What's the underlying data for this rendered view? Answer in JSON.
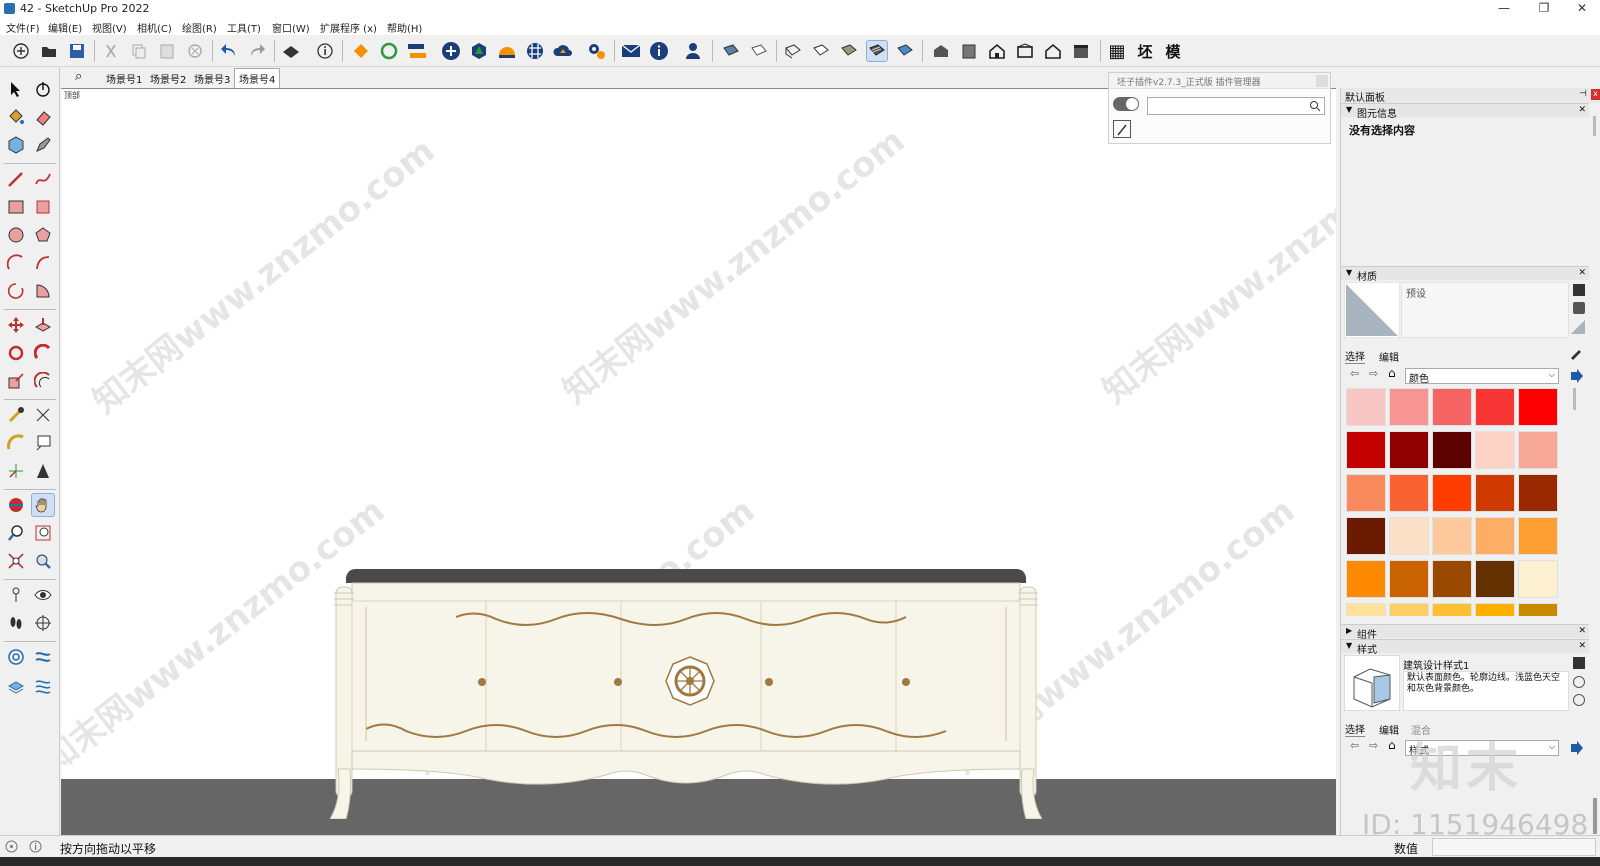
{
  "window": {
    "title": "42 - SketchUp Pro 2022",
    "controls": [
      "—",
      "❐",
      "✕"
    ]
  },
  "menu": [
    "文件(F)",
    "编辑(E)",
    "视图(V)",
    "相机(C)",
    "绘图(R)",
    "工具(T)",
    "窗口(W)",
    "扩展程序 (x)",
    "帮助(H)"
  ],
  "toolbar_right_labels": {
    "table": "▦",
    "huai": "坯",
    "mo": "模"
  },
  "scenes": {
    "search_icon": "⌕",
    "tabs": [
      "场景号1",
      "场景号2",
      "场景号3",
      "场景号4"
    ],
    "active_index": 3
  },
  "viewport": {
    "corner_label": "顶部",
    "watermark": "知末网www.znzmo.com"
  },
  "plugin_panel": {
    "title": "坯子插件v2.7.3_正式版 插件管理器",
    "search_placeholder": ""
  },
  "right_panel": {
    "title": "默认面板",
    "entity_info": {
      "header": "图元信息",
      "empty_text": "没有选择内容"
    },
    "materials": {
      "header": "材质",
      "preset_label": "预设",
      "tab_select": "选择",
      "tab_edit": "编辑",
      "library": "颜色",
      "swatches": [
        "#f9c6c6",
        "#f79595",
        "#f66363",
        "#f73535",
        "#ff0000",
        "#c40000",
        "#8f0000",
        "#5c0000",
        "#fcd2c7",
        "#f8a896",
        "#f98a5e",
        "#fa6233",
        "#ff3d00",
        "#d03a00",
        "#9a2800",
        "#6b1b00",
        "#fde0c8",
        "#fcc79a",
        "#fdad66",
        "#fd9f33",
        "#fd8900",
        "#c96200",
        "#9a4a00",
        "#643000",
        "#fdf0d0",
        "#fde09a",
        "#fdd066",
        "#fdc033",
        "#fdb000",
        "#c78a00"
      ]
    },
    "components": {
      "header": "组件"
    },
    "styles": {
      "header": "样式",
      "style_name": "建筑设计样式1",
      "description": "默认表面颜色。轮廓边线。浅蓝色天空和灰色背景颜色。",
      "tab_select": "选择",
      "tab_edit": "编辑",
      "tab_mix": "混合",
      "library_value": "样式"
    }
  },
  "status": {
    "hint": "按方向拖动以平移",
    "value_label": "数值"
  },
  "overlay": {
    "logo_text": "知末",
    "id_text": "ID: 1151946498"
  },
  "colors": {
    "accent_blue": "#1e5aa8",
    "ground": "#666666",
    "cabinet_body": "#f7f4ea",
    "cabinet_top": "#4a4a4a",
    "ornament": "#a07840"
  }
}
